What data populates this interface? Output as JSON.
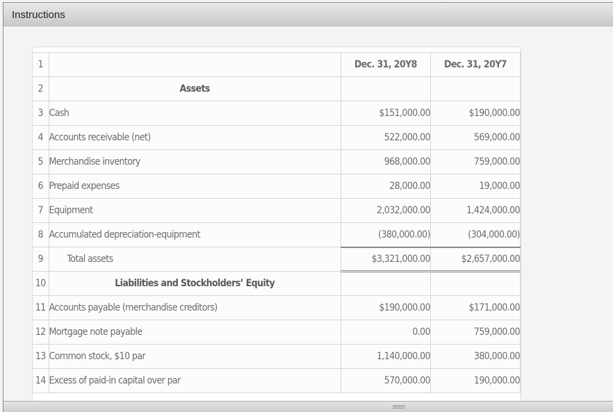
{
  "header": {
    "title": "Instructions"
  },
  "table": {
    "columns": [
      "",
      "Dec. 31, 20Y8",
      "Dec. 31, 20Y7"
    ],
    "rows": [
      {
        "num": "1",
        "label": "",
        "y8": "Dec. 31, 20Y8",
        "y7": "Dec. 31, 20Y7",
        "type": "header"
      },
      {
        "num": "2",
        "label": "Assets",
        "y8": "",
        "y7": "",
        "type": "heading"
      },
      {
        "num": "3",
        "label": "Cash",
        "y8": "$151,000.00",
        "y7": "$190,000.00",
        "type": "item"
      },
      {
        "num": "4",
        "label": "Accounts receivable (net)",
        "y8": "522,000.00",
        "y7": "569,000.00",
        "type": "item"
      },
      {
        "num": "5",
        "label": "Merchandise inventory",
        "y8": "968,000.00",
        "y7": "759,000.00",
        "type": "item"
      },
      {
        "num": "6",
        "label": "Prepaid expenses",
        "y8": "28,000.00",
        "y7": "19,000.00",
        "type": "item"
      },
      {
        "num": "7",
        "label": "Equipment",
        "y8": "2,032,000.00",
        "y7": "1,424,000.00",
        "type": "item"
      },
      {
        "num": "8",
        "label": "Accumulated depreciation-equipment",
        "y8": "(380,000.00)",
        "y7": "(304,000.00)",
        "type": "item"
      },
      {
        "num": "9",
        "label": "Total assets",
        "y8": "$3,321,000.00",
        "y7": "$2,657,000.00",
        "type": "total"
      },
      {
        "num": "10",
        "label": "Liabilities and Stockholders’ Equity",
        "y8": "",
        "y7": "",
        "type": "heading"
      },
      {
        "num": "11",
        "label": "Accounts payable (merchandise creditors)",
        "y8": "$190,000.00",
        "y7": "$171,000.00",
        "type": "item"
      },
      {
        "num": "12",
        "label": "Mortgage note payable",
        "y8": "0.00",
        "y7": "759,000.00",
        "type": "item"
      },
      {
        "num": "13",
        "label": "Common stock, $10 par",
        "y8": "1,140,000.00",
        "y7": "380,000.00",
        "type": "item"
      },
      {
        "num": "14",
        "label": "Excess of paid-in capital over par",
        "y8": "570,000.00",
        "y7": "190,000.00",
        "type": "item"
      }
    ]
  },
  "footer": {
    "resize_handle": "resize-grip-icon"
  }
}
